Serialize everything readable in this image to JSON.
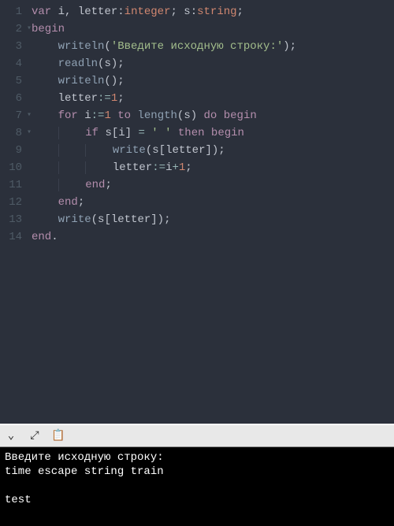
{
  "editor": {
    "lines": [
      {
        "n": 1,
        "fold": false,
        "indent": 0,
        "tokens": [
          [
            "kw",
            "var"
          ],
          [
            "punct",
            " "
          ],
          [
            "ident",
            "i"
          ],
          [
            "punct",
            ", "
          ],
          [
            "ident",
            "letter"
          ],
          [
            "punct",
            ":"
          ],
          [
            "type",
            "integer"
          ],
          [
            "punct",
            "; "
          ],
          [
            "ident",
            "s"
          ],
          [
            "punct",
            ":"
          ],
          [
            "type",
            "string"
          ],
          [
            "punct",
            ";"
          ]
        ]
      },
      {
        "n": 2,
        "fold": true,
        "indent": 0,
        "tokens": [
          [
            "kw",
            "begin"
          ]
        ]
      },
      {
        "n": 3,
        "fold": false,
        "indent": 1,
        "tokens": [
          [
            "func",
            "writeln"
          ],
          [
            "punct",
            "("
          ],
          [
            "str",
            "'Введите исходную строку:'"
          ],
          [
            "punct",
            ");"
          ]
        ]
      },
      {
        "n": 4,
        "fold": false,
        "indent": 1,
        "tokens": [
          [
            "func",
            "readln"
          ],
          [
            "punct",
            "("
          ],
          [
            "ident",
            "s"
          ],
          [
            "punct",
            ");"
          ]
        ]
      },
      {
        "n": 5,
        "fold": false,
        "indent": 1,
        "tokens": [
          [
            "func",
            "writeln"
          ],
          [
            "punct",
            "();"
          ]
        ]
      },
      {
        "n": 6,
        "fold": false,
        "indent": 1,
        "tokens": [
          [
            "ident",
            "letter"
          ],
          [
            "oper",
            ":="
          ],
          [
            "num",
            "1"
          ],
          [
            "punct",
            ";"
          ]
        ]
      },
      {
        "n": 7,
        "fold": true,
        "indent": 1,
        "tokens": [
          [
            "kw",
            "for"
          ],
          [
            "punct",
            " "
          ],
          [
            "ident",
            "i"
          ],
          [
            "oper",
            ":="
          ],
          [
            "num",
            "1"
          ],
          [
            "punct",
            " "
          ],
          [
            "kw",
            "to"
          ],
          [
            "punct",
            " "
          ],
          [
            "func",
            "length"
          ],
          [
            "punct",
            "("
          ],
          [
            "ident",
            "s"
          ],
          [
            "punct",
            ") "
          ],
          [
            "kw",
            "do"
          ],
          [
            "punct",
            " "
          ],
          [
            "kw",
            "begin"
          ]
        ]
      },
      {
        "n": 8,
        "fold": true,
        "indent": 2,
        "tokens": [
          [
            "kw",
            "if"
          ],
          [
            "punct",
            " "
          ],
          [
            "ident",
            "s"
          ],
          [
            "punct",
            "["
          ],
          [
            "ident",
            "i"
          ],
          [
            "punct",
            "] "
          ],
          [
            "oper",
            "="
          ],
          [
            "punct",
            " "
          ],
          [
            "str",
            "' '"
          ],
          [
            "punct",
            " "
          ],
          [
            "kw",
            "then"
          ],
          [
            "punct",
            " "
          ],
          [
            "kw",
            "begin"
          ]
        ]
      },
      {
        "n": 9,
        "fold": false,
        "indent": 3,
        "tokens": [
          [
            "func",
            "write"
          ],
          [
            "punct",
            "("
          ],
          [
            "ident",
            "s"
          ],
          [
            "punct",
            "["
          ],
          [
            "ident",
            "letter"
          ],
          [
            "punct",
            "]);"
          ]
        ]
      },
      {
        "n": 10,
        "fold": false,
        "indent": 3,
        "tokens": [
          [
            "ident",
            "letter"
          ],
          [
            "oper",
            ":="
          ],
          [
            "ident",
            "i"
          ],
          [
            "oper",
            "+"
          ],
          [
            "num",
            "1"
          ],
          [
            "punct",
            ";"
          ]
        ]
      },
      {
        "n": 11,
        "fold": false,
        "indent": 2,
        "tokens": [
          [
            "kw",
            "end"
          ],
          [
            "punct",
            ";"
          ]
        ]
      },
      {
        "n": 12,
        "fold": false,
        "indent": 1,
        "tokens": [
          [
            "kw",
            "end"
          ],
          [
            "punct",
            ";"
          ]
        ]
      },
      {
        "n": 13,
        "fold": false,
        "indent": 1,
        "tokens": [
          [
            "func",
            "write"
          ],
          [
            "punct",
            "("
          ],
          [
            "ident",
            "s"
          ],
          [
            "punct",
            "["
          ],
          [
            "ident",
            "letter"
          ],
          [
            "punct",
            "]);"
          ]
        ]
      },
      {
        "n": 14,
        "fold": false,
        "indent": 0,
        "tokens": [
          [
            "kw",
            "end"
          ],
          [
            "punct",
            "."
          ]
        ]
      }
    ]
  },
  "toolbar": {
    "collapse_icon": "⌄",
    "expand_icon": "⤢",
    "copy_icon": "📋"
  },
  "console": {
    "lines": [
      "Введите исходную строку:",
      "time escape string train",
      "",
      "test"
    ]
  }
}
